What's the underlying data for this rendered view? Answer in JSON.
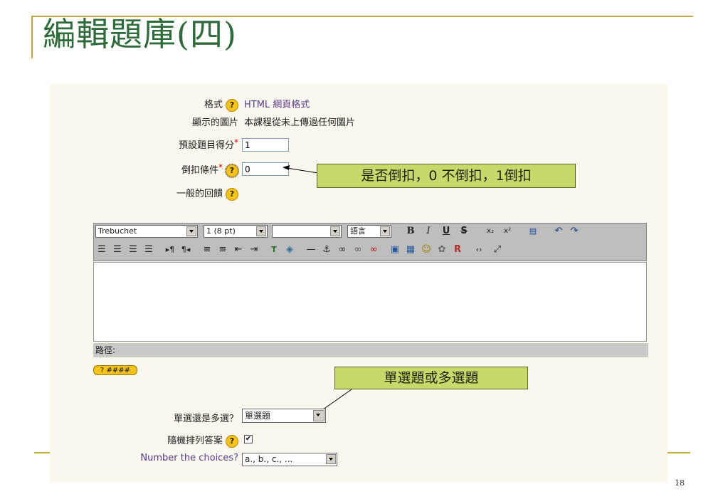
{
  "slide": {
    "title": "編輯題庫(四)",
    "page_number": "18"
  },
  "form": {
    "format_label": "格式",
    "format_value": "HTML 網頁格式",
    "images_label": "顯示的圖片",
    "images_value": "本課程從未上傳過任何圖片",
    "default_grade_label": "預設題目得分",
    "default_grade_value": "1",
    "penalty_label": "倒扣條件",
    "penalty_value": "0",
    "feedback_label": "一般的回饋",
    "single_multi_label": "單選還是多選？",
    "single_multi_value": "單選題",
    "shuffle_label": "隨機排列答案",
    "shuffle_checked": "✔",
    "numbering_label": "Number the choices?",
    "numbering_value": "a., b., c., ..."
  },
  "callouts": {
    "penalty_note": "是否倒扣，0 不倒扣，1倒扣",
    "single_multi_note": "單選題或多選題"
  },
  "editor": {
    "font_value": "Trebuchet",
    "size_value": "1 (8 pt)",
    "style_value": "",
    "lang_value": "語言",
    "path_label": "路徑:",
    "help_button_label": "? ####"
  },
  "colors": {
    "title": "#2e6b3a",
    "accent_bar": "#c8a838",
    "callout_bg": "#c9d86a",
    "panel_bg": "#faf8ee"
  }
}
